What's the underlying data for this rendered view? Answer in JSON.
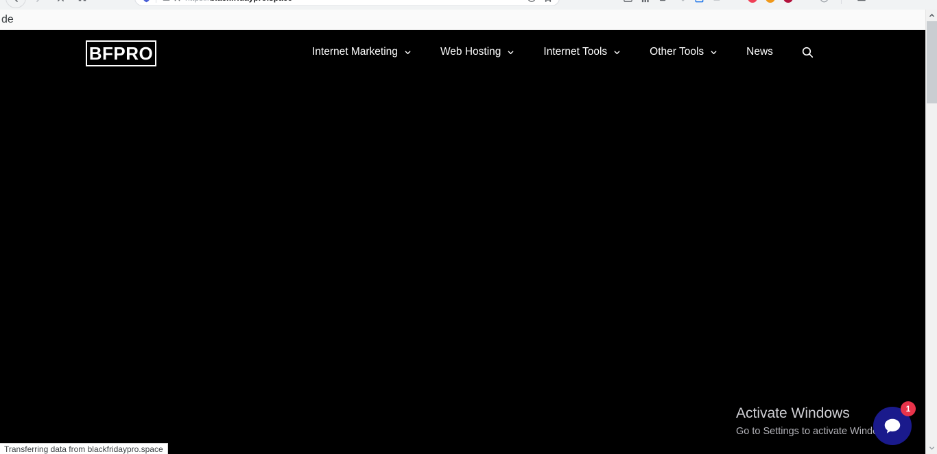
{
  "browser": {
    "url_scheme": "https://",
    "url_host": "blackfridaypro.space",
    "back_icon": "back-arrow-icon",
    "forward_icon": "forward-arrow-icon",
    "stop_icon": "stop-x-icon",
    "home_icon": "home-icon",
    "shield_icon": "shield-icon",
    "reader_icon": "reader-view-icon",
    "tracking_icon": "tracking-protection-icon",
    "pocket_icon": "save-to-pocket-icon",
    "bookmark_icon": "bookmark-star-icon",
    "menu_icon": "app-menu-icon",
    "extensions": [
      {
        "name": "extension-icon-screenshot",
        "color": "#5f6368"
      },
      {
        "name": "extension-icon-analytics",
        "color": "#5f6368"
      },
      {
        "name": "extension-icon-video",
        "color": "#5f6368"
      },
      {
        "name": "extension-icon-tools",
        "color": "#9aa0a6"
      },
      {
        "name": "extension-icon-calendar",
        "color": "#1a73e8"
      },
      {
        "name": "extension-icon-cloud",
        "color": "#9aa0a6"
      },
      {
        "name": "extension-icon-key",
        "color": "#9aa0a6"
      },
      {
        "name": "extension-icon-pocket",
        "color": "#ef4056"
      },
      {
        "name": "extension-icon-orange",
        "color": "#f09819"
      },
      {
        "name": "extension-icon-crimson",
        "color": "#b3123c"
      },
      {
        "name": "extension-icon-grid",
        "color": "#bdc1c6"
      },
      {
        "name": "extension-icon-account",
        "color": "#9aa0a6"
      }
    ]
  },
  "bookmarks_bar": {
    "visible_label": "de"
  },
  "site": {
    "logo_text": "BFPRO",
    "nav": [
      {
        "label": "Internet Marketing",
        "has_dropdown": true,
        "name": "nav-item-internet-marketing"
      },
      {
        "label": "Web Hosting",
        "has_dropdown": true,
        "name": "nav-item-web-hosting"
      },
      {
        "label": "Internet Tools",
        "has_dropdown": true,
        "name": "nav-item-internet-tools"
      },
      {
        "label": "Other Tools",
        "has_dropdown": true,
        "name": "nav-item-other-tools"
      },
      {
        "label": "News",
        "has_dropdown": false,
        "name": "nav-item-news"
      }
    ],
    "search_icon": "search-icon",
    "background_color": "#000000",
    "text_color": "#ffffff",
    "body_empty": true
  },
  "chat_widget": {
    "icon": "chat-bubble-icon",
    "badge_count": "1",
    "button_color": "#1a1a8c",
    "badge_color": "#e8334a"
  },
  "windows_activation": {
    "title": "Activate Windows",
    "subtitle": "Go to Settings to activate Windows."
  },
  "status_bar": {
    "text": "Transferring data from blackfridaypro.space"
  },
  "scrollbar": {
    "up_arrow": "scroll-up-arrow",
    "down_arrow": "scroll-down-arrow",
    "position": "top"
  }
}
